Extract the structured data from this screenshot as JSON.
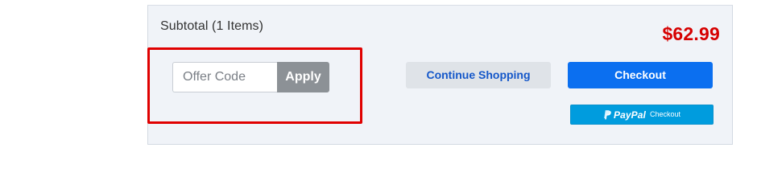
{
  "cart": {
    "subtotal_label": "Subtotal (1 Items)",
    "subtotal_amount": "$62.99"
  },
  "offer": {
    "placeholder": "Offer Code",
    "value": "",
    "apply_label": "Apply"
  },
  "actions": {
    "continue_label": "Continue Shopping",
    "checkout_label": "Checkout",
    "paypal_brand": "PayPal",
    "paypal_checkout_label": "Checkout"
  },
  "icons": {
    "paypal": "paypal-logo-icon"
  },
  "colors": {
    "panel_background": "#f0f3f8",
    "price": "#d60000",
    "highlight": "#e00000",
    "apply_button": "#8c9196",
    "continue_button_bg": "#dfe3e8",
    "continue_button_text": "#1457c9",
    "checkout_button": "#0b6ff0",
    "paypal_button": "#009cde"
  }
}
